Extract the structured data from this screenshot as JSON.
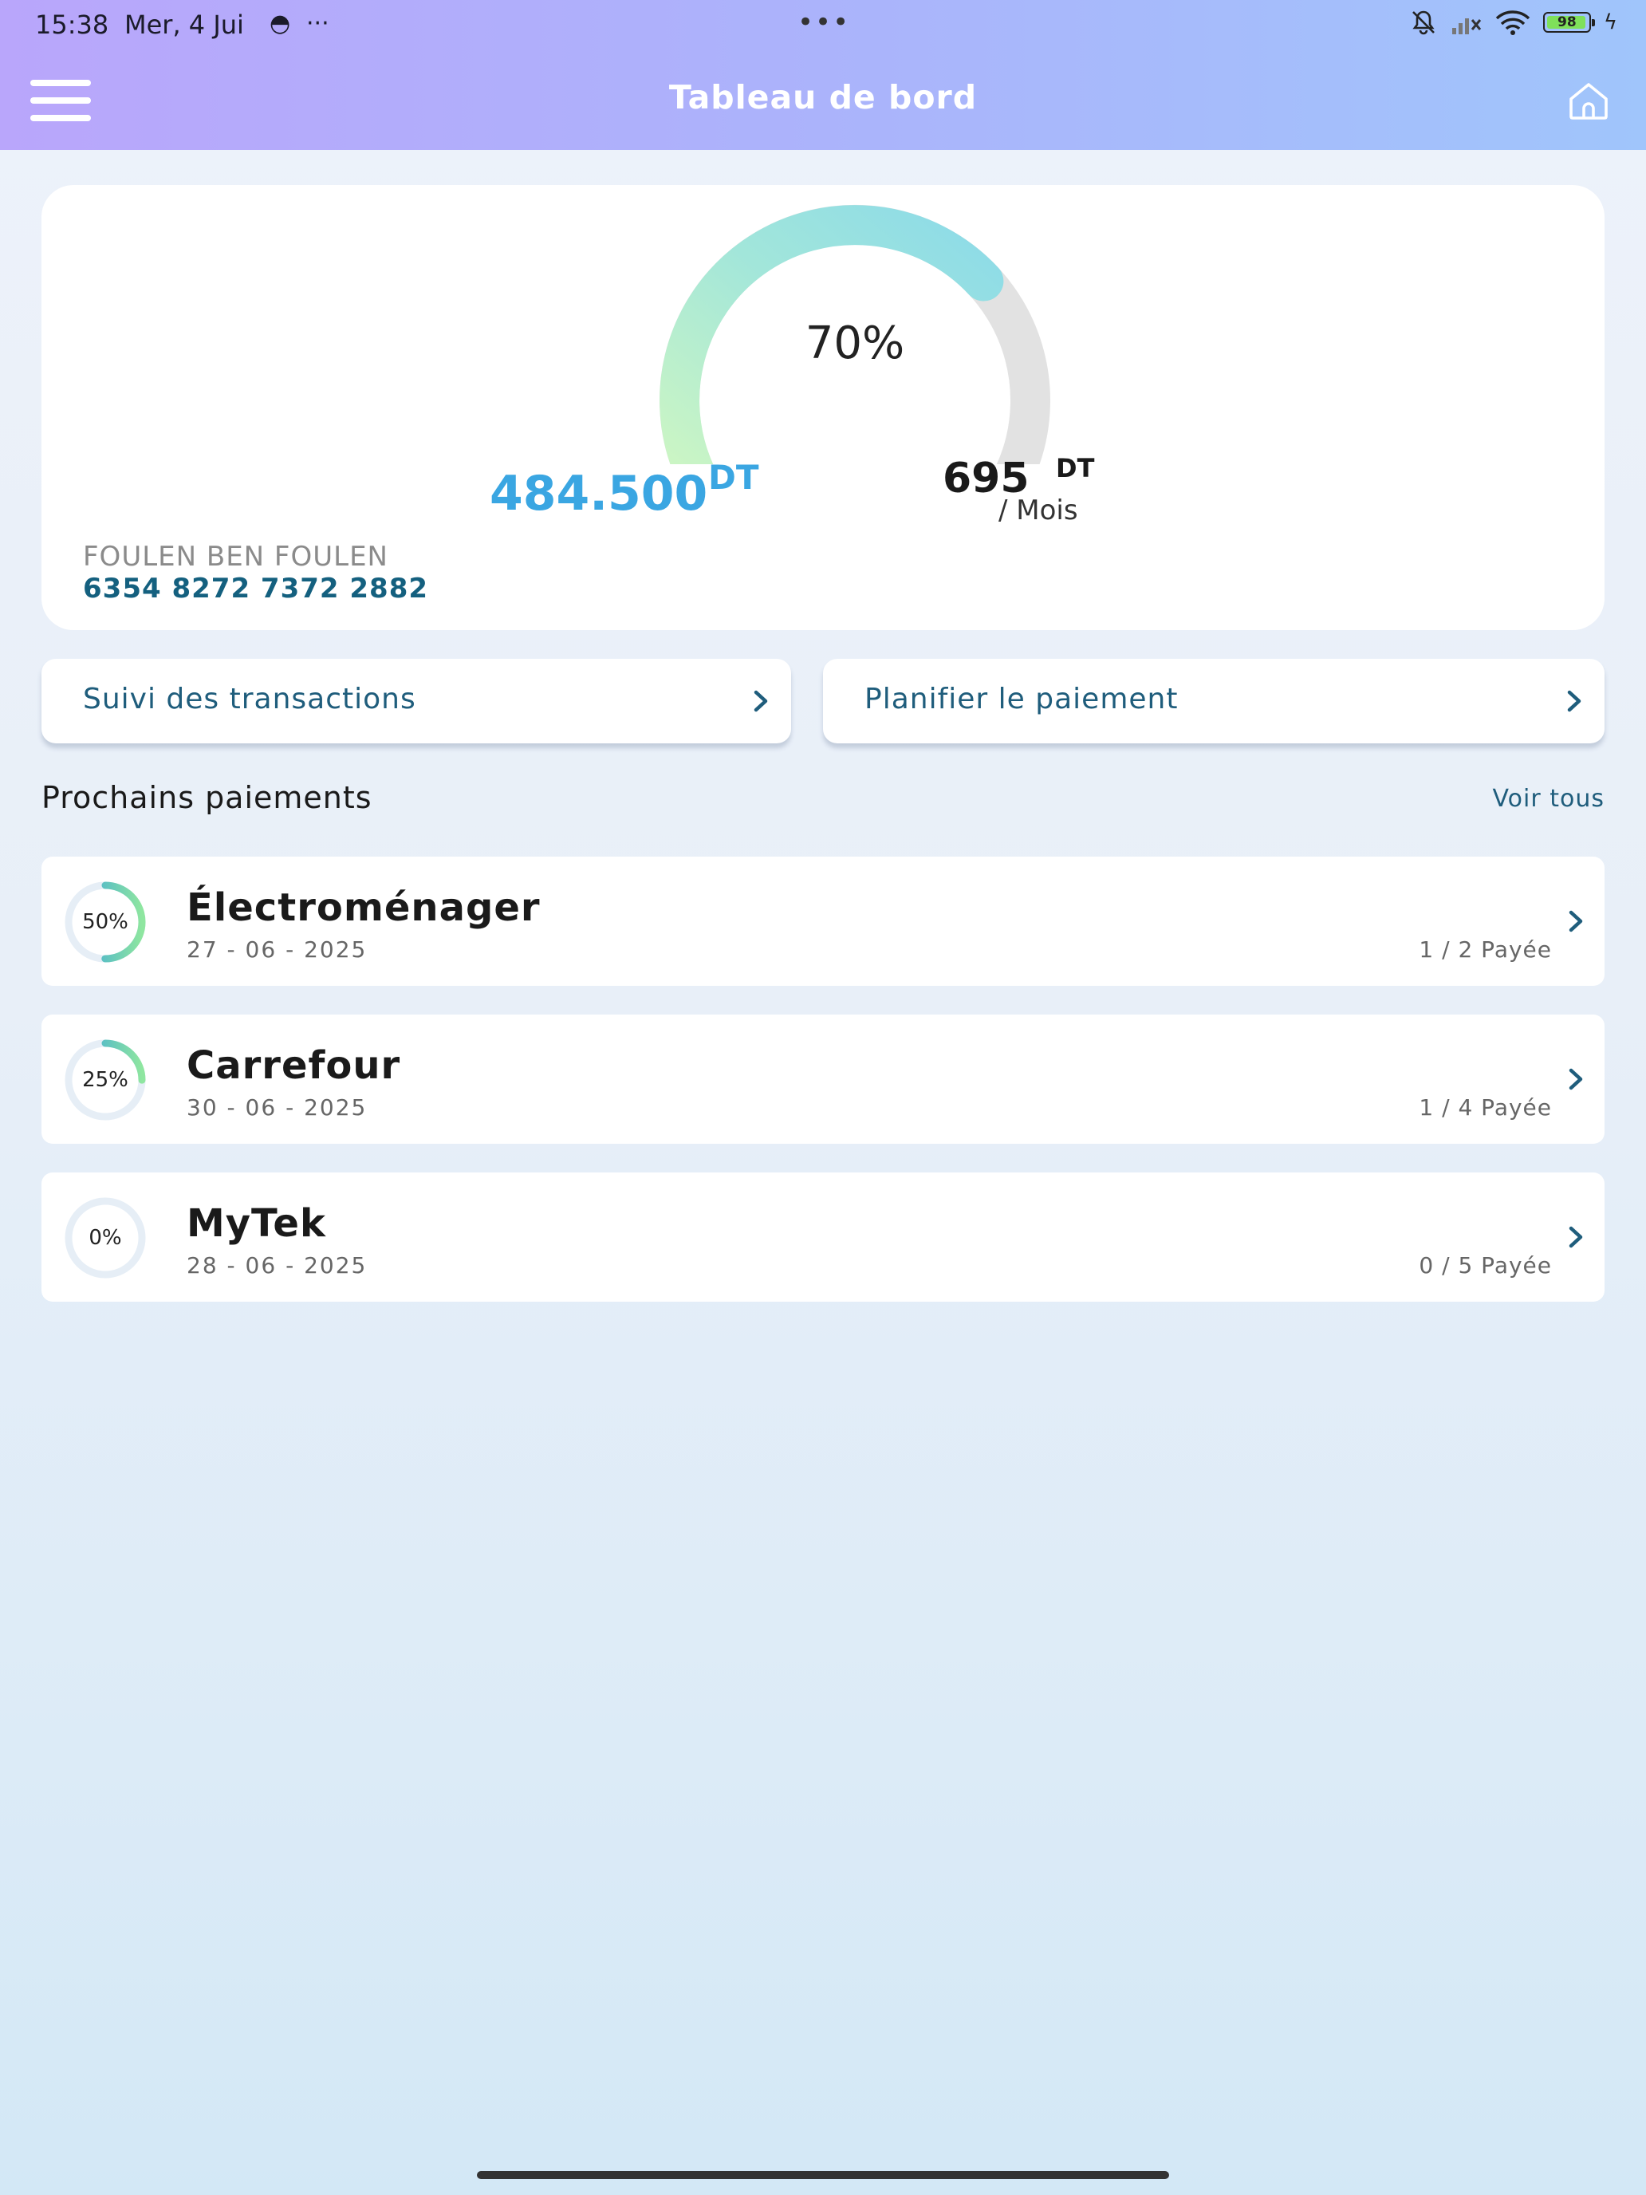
{
  "status_bar": {
    "time": "15:38",
    "date": "Mer, 4 Jui",
    "more": "···",
    "center_dots": "•••",
    "battery": "98"
  },
  "header": {
    "title": "Tableau de bord"
  },
  "balance_card": {
    "gauge_percent": "70%",
    "gauge_fraction": 0.7,
    "amount": "484.500",
    "amount_unit": "DT",
    "limit": "695",
    "limit_unit": "DT",
    "period": "/ Mois",
    "holder_name": "FOULEN BEN FOULEN",
    "card_number": "6354 8272 7372 2882"
  },
  "actions": {
    "track_label": "Suivi des transactions",
    "plan_label": "Planifier le paiement"
  },
  "upcoming": {
    "title": "Prochains paiements",
    "see_all": "Voir tous",
    "items": [
      {
        "name": "Électroménager",
        "date": "27 - 06 - 2025",
        "count": "1 / 2 Payée",
        "percent_label": "50%",
        "percent": 0.5
      },
      {
        "name": "Carrefour",
        "date": "30 - 06 - 2025",
        "count": "1 / 4 Payée",
        "percent_label": "25%",
        "percent": 0.25
      },
      {
        "name": "MyTek",
        "date": "28 - 06 - 2025",
        "count": "0 / 5 Payée",
        "percent_label": "0%",
        "percent": 0
      }
    ]
  },
  "colors": {
    "accent": "#3aa6e2",
    "dark_blue": "#1f5d7c",
    "gauge_start": "#c9f5c4",
    "gauge_end": "#8fe0e8",
    "gauge_track": "#e3e3e3"
  }
}
